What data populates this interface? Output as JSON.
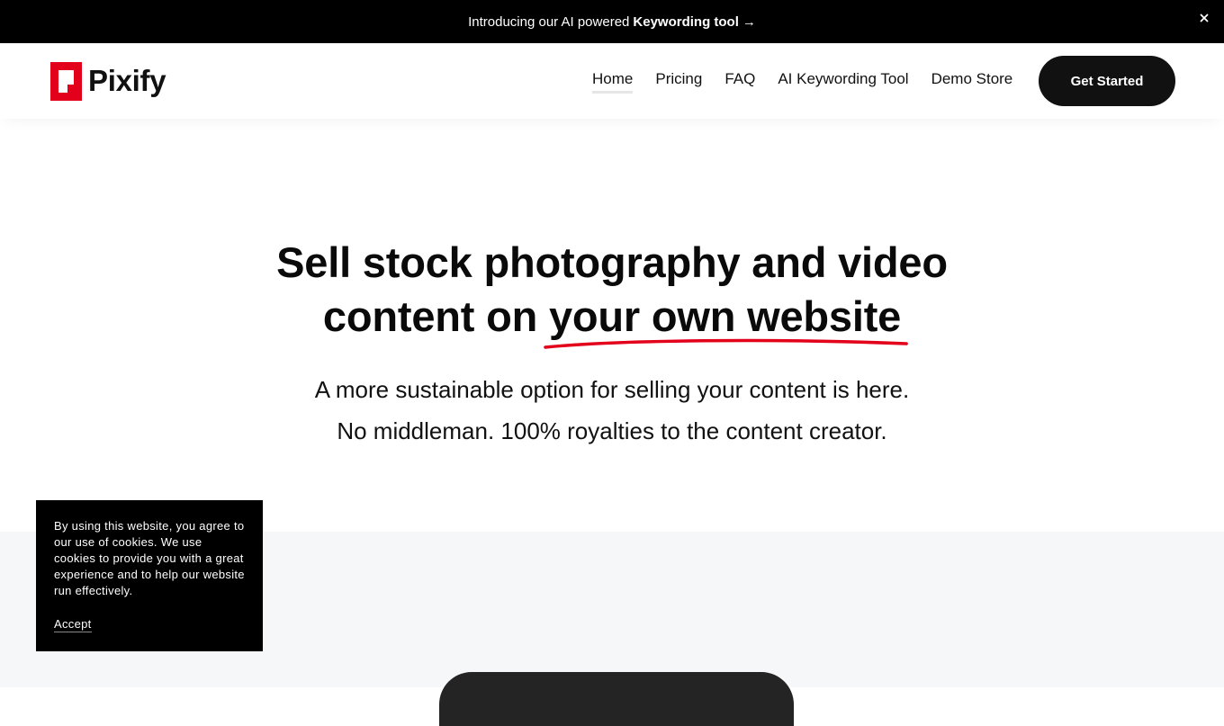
{
  "announcement": {
    "text": "Introducing our AI powered",
    "bold_text": "Keywording tool",
    "arrow": "→",
    "close_icon": "×"
  },
  "header": {
    "logo_text": "Pixify",
    "brand_color": "#e3001b",
    "nav": [
      {
        "label": "Home",
        "active": true
      },
      {
        "label": "Pricing",
        "active": false
      },
      {
        "label": "FAQ",
        "active": false
      },
      {
        "label": "AI Keywording Tool",
        "active": false
      },
      {
        "label": "Demo Store",
        "active": false
      }
    ],
    "cta_label": "Get Started"
  },
  "hero": {
    "title_line1": "Sell stock photography and video",
    "title_line2_prefix": "content on",
    "title_line2_highlight": "your own website",
    "underline_color": "#e3001b",
    "subtitle_line1": "A more sustainable option for selling your content is here.",
    "subtitle_line2": "No middleman. 100% royalties to the content creator."
  },
  "cookie_banner": {
    "text": "By using this website, you agree to our use of cookies. We use cookies to provide you with a great experience and to help our website run effectively.",
    "accept_label": "Accept"
  }
}
